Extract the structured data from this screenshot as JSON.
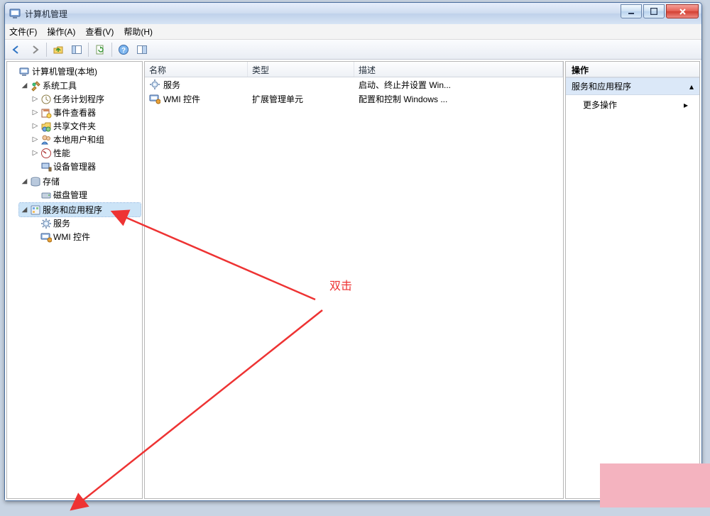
{
  "window": {
    "title": "计算机管理"
  },
  "menubar": {
    "file": "文件(F)",
    "action": "操作(A)",
    "view": "查看(V)",
    "help": "帮助(H)"
  },
  "tree": {
    "root": "计算机管理(本地)",
    "systools": {
      "label": "系统工具",
      "task_scheduler": "任务计划程序",
      "event_viewer": "事件查看器",
      "shared_folders": "共享文件夹",
      "local_users": "本地用户和组",
      "performance": "性能",
      "device_mgr": "设备管理器"
    },
    "storage": {
      "label": "存储",
      "disk_mgmt": "磁盘管理"
    },
    "services_apps": {
      "label": "服务和应用程序",
      "services": "服务",
      "wmi": "WMI 控件"
    }
  },
  "list": {
    "headers": {
      "name": "名称",
      "type": "类型",
      "desc": "描述"
    },
    "rows": [
      {
        "icon": "gear",
        "name": "服务",
        "type": "",
        "desc": "启动、终止并设置 Win..."
      },
      {
        "icon": "computer",
        "name": "WMI 控件",
        "type": "扩展管理单元",
        "desc": "配置和控制 Windows ..."
      }
    ]
  },
  "actions": {
    "header": "操作",
    "section": "服务和应用程序",
    "more": "更多操作"
  },
  "annotation": {
    "label": "双击"
  }
}
